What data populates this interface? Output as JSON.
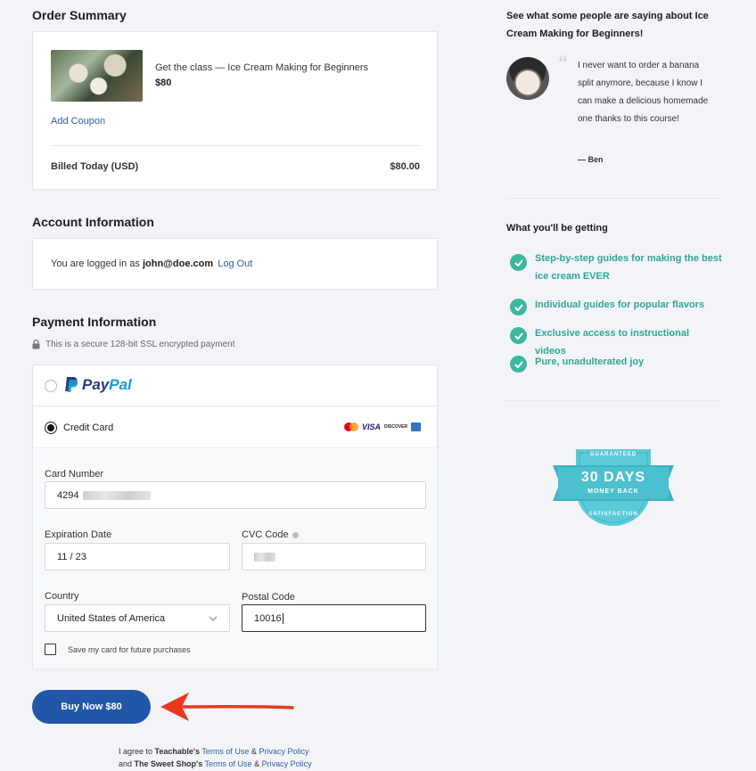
{
  "order_summary": {
    "title": "Order Summary",
    "product_name": "Get the class — Ice Cream Making for Beginners",
    "product_price": "$80",
    "add_coupon": "Add Coupon",
    "billed_label": "Billed Today (USD)",
    "billed_amount": "$80.00"
  },
  "account": {
    "title": "Account Information",
    "logged_in_text": "You are logged in as",
    "email": "john@doe.com",
    "logout": "Log Out"
  },
  "payment": {
    "title": "Payment Information",
    "secure_note": "This is a secure 128-bit SSL encrypted payment",
    "paypal_brand_pay": "Pay",
    "paypal_brand_pal": "Pal",
    "credit_card_label": "Credit Card",
    "card_number_label": "Card Number",
    "card_number_value": "4294",
    "expiration_label": "Expiration Date",
    "expiration_value": "11 / 23",
    "cvc_label": "CVC Code",
    "country_label": "Country",
    "country_value": "United States of America",
    "postal_label": "Postal Code",
    "postal_value": "10016",
    "save_card_label": "Save my card for future purchases",
    "card_brands": [
      "VISA",
      "DISCOVER"
    ]
  },
  "buy": {
    "label": "Buy Now $80"
  },
  "terms": {
    "line1_prefix": "I agree to",
    "line1_company": "Teachable's",
    "line2_prefix": "and",
    "line2_company": "The Sweet Shop's",
    "terms_link": "Terms of Use",
    "amp": "&",
    "privacy_link": "Privacy Policy"
  },
  "testimonial": {
    "heading": "See what some people are saying about Ice Cream Making for Beginners!",
    "quote": "I never want to order a banana split anymore, because I know I can make a delicious homemade one thanks to this course!",
    "author": "— Ben"
  },
  "benefits": {
    "heading": "What you'll be getting",
    "items": [
      "Step-by-step guides for making the best ice cream EVER",
      "Individual guides for popular flavors",
      "Exclusive access to instructional videos",
      "Pure, unadulterated joy"
    ]
  },
  "badge": {
    "top": "GUARANTEED",
    "main": "30 DAYS",
    "sub": "MONEY BACK",
    "bottom": "SATISFACTION"
  },
  "colors": {
    "teal": "#3cb8a0",
    "button": "#2256a8",
    "arrow": "#e8391f",
    "badge": "#5ccbd8"
  }
}
